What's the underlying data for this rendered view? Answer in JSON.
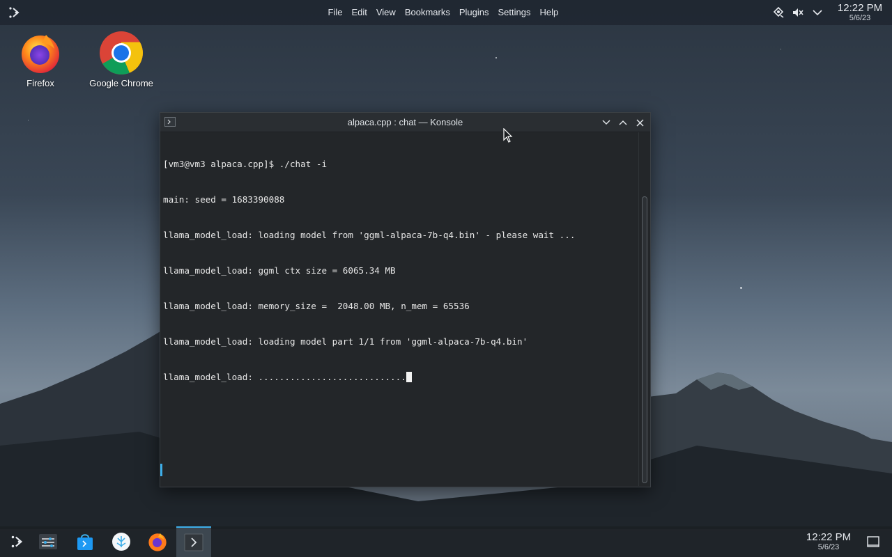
{
  "menu": [
    "File",
    "Edit",
    "View",
    "Bookmarks",
    "Plugins",
    "Settings",
    "Help"
  ],
  "top_clock": {
    "time": "12:22 PM",
    "date": "5/6/23"
  },
  "desktop_icons": [
    {
      "label": "Firefox",
      "icon": "firefox-icon"
    },
    {
      "label": "Google Chrome",
      "icon": "chrome-icon"
    }
  ],
  "window": {
    "title": "alpaca.cpp : chat — Konsole",
    "terminal_lines": [
      "[vm3@vm3 alpaca.cpp]$ ./chat -i",
      "main: seed = 1683390088",
      "llama_model_load: loading model from 'ggml-alpaca-7b-q4.bin' - please wait ...",
      "llama_model_load: ggml ctx size = 6065.34 MB",
      "llama_model_load: memory_size =  2048.00 MB, n_mem = 65536",
      "llama_model_load: loading model part 1/1 from 'ggml-alpaca-7b-q4.bin'",
      "llama_model_load: ............................"
    ]
  },
  "taskbar_items": [
    "app-launcher-icon",
    "system-settings-icon",
    "discover-store-icon",
    "plasma-vault-icon",
    "firefox-icon",
    "konsole-icon"
  ],
  "bottom_clock": {
    "time": "12:22 PM",
    "date": "5/6/23"
  },
  "colors": {
    "accent": "#3daee9",
    "terminal_bg": "#232629"
  }
}
